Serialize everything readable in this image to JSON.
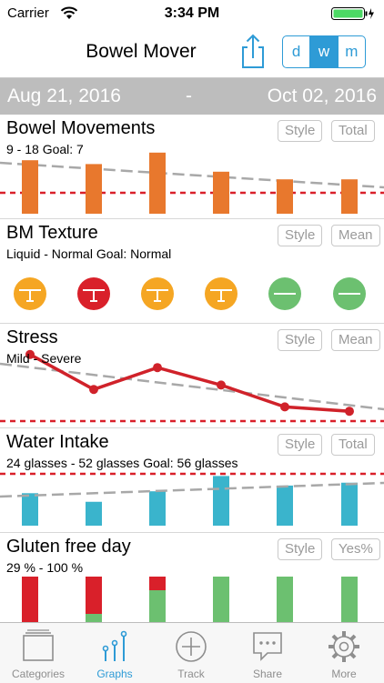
{
  "status": {
    "carrier": "Carrier",
    "time": "3:34 PM"
  },
  "header": {
    "title": "Bowel Mover",
    "segments": [
      "d",
      "w",
      "m"
    ],
    "active_segment": "w"
  },
  "date_range": {
    "start": "Aug 21, 2016",
    "separator": "-",
    "end": "Oct 02, 2016"
  },
  "sections": [
    {
      "title": "Bowel Movements",
      "subtitle": "9  - 18  Goal: 7",
      "buttons": [
        "Style",
        "Total"
      ]
    },
    {
      "title": "BM Texture",
      "subtitle": "Liquid - Normal Goal: Normal",
      "buttons": [
        "Style",
        "Mean"
      ]
    },
    {
      "title": "Stress",
      "subtitle": "Mild - Severe",
      "buttons": [
        "Style",
        "Mean"
      ]
    },
    {
      "title": "Water Intake",
      "subtitle": "24 glasses - 52 glasses Goal: 56 glasses",
      "buttons": [
        "Style",
        "Total"
      ]
    },
    {
      "title": "Gluten free day",
      "subtitle": " 29 % - 100 %",
      "buttons": [
        "Style",
        "Yes%"
      ]
    }
  ],
  "tabs": [
    {
      "label": "Categories",
      "icon": "categories-icon"
    },
    {
      "label": "Graphs",
      "icon": "graphs-icon"
    },
    {
      "label": "Track",
      "icon": "track-icon"
    },
    {
      "label": "Share",
      "icon": "share-icon"
    },
    {
      "label": "More",
      "icon": "more-icon"
    }
  ],
  "active_tab": "Graphs",
  "colors": {
    "accent": "#2e9bd6",
    "bar_orange": "#e8782d",
    "goal_red": "#d9202a",
    "trend_gray": "#a8a8a8",
    "water_teal": "#3ab4cc",
    "green": "#6cc070",
    "yellow": "#f5a623",
    "line_red": "#d0222a"
  },
  "chart_data": [
    {
      "type": "bar",
      "series": [
        {
          "values": [
            14,
            13,
            16,
            11,
            9,
            9
          ]
        }
      ],
      "goal": 7
    },
    {
      "type": "scatter",
      "series": [
        {
          "values": [
            "liquid",
            "hard",
            "liquid",
            "liquid",
            "normal",
            "normal"
          ]
        }
      ],
      "goal": "normal"
    },
    {
      "type": "line",
      "series": [
        {
          "values": [
            4.9,
            4.1,
            4.6,
            4.2,
            3.7,
            3.6
          ]
        }
      ]
    },
    {
      "type": "bar",
      "series": [
        {
          "values": [
            34,
            25,
            36,
            52,
            42,
            45
          ]
        }
      ],
      "goal": 56
    },
    {
      "type": "bar",
      "series": [
        {
          "name": "yes",
          "values": [
            0,
            18,
            70,
            100,
            100,
            100
          ]
        }
      ]
    }
  ]
}
